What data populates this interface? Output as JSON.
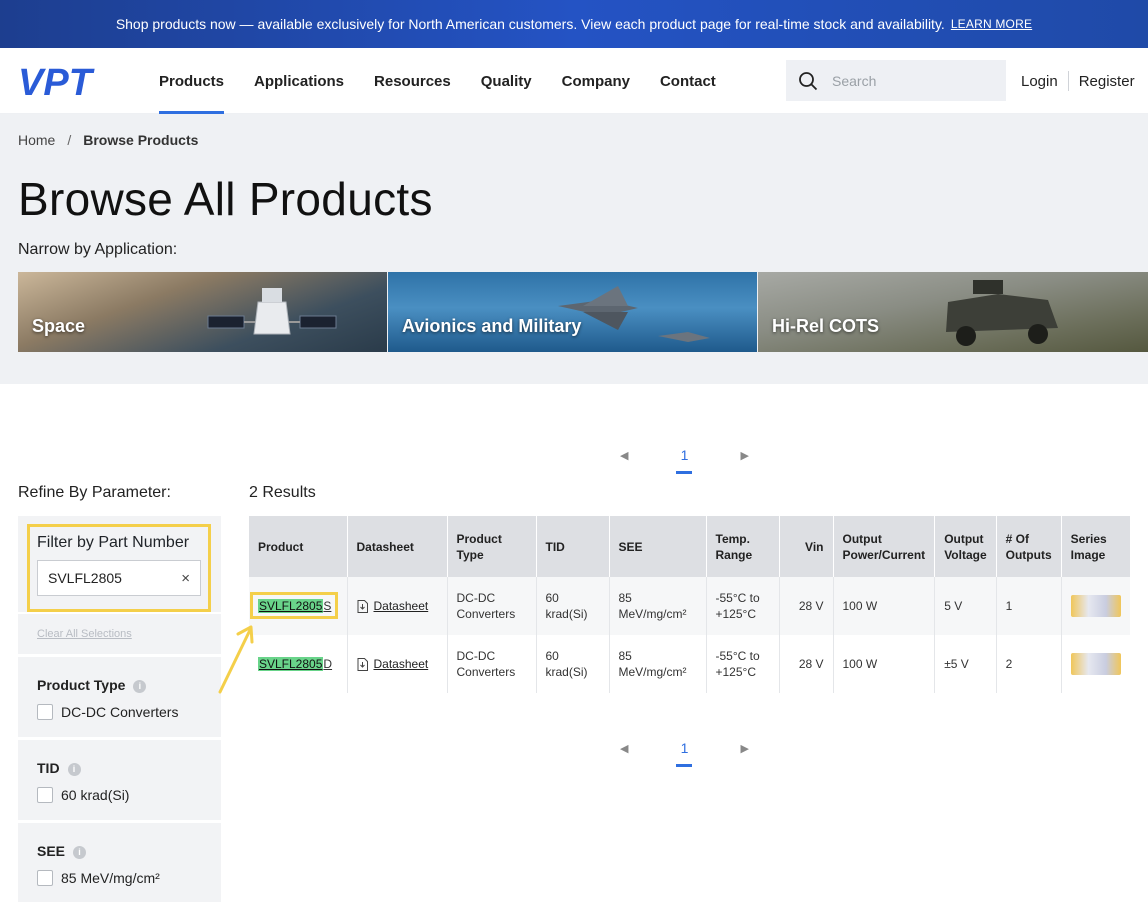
{
  "banner": {
    "text": "Shop products now — available exclusively for North American customers. View each product page for real-time stock and availability.",
    "link": "LEARN MORE"
  },
  "header": {
    "logo_text": "VPT",
    "nav": [
      "Products",
      "Applications",
      "Resources",
      "Quality",
      "Company",
      "Contact"
    ],
    "active_nav": "Products",
    "search_placeholder": "Search",
    "login": "Login",
    "register": "Register"
  },
  "breadcrumb": {
    "home": "Home",
    "separator": "/",
    "current": "Browse Products"
  },
  "page_title": "Browse All Products",
  "narrow_label": "Narrow by Application:",
  "applications": [
    "Space",
    "Avionics and Military",
    "Hi-Rel COTS"
  ],
  "pagination": {
    "current": "1"
  },
  "refine_label": "Refine By Parameter:",
  "results_label": "2 Results",
  "filters": {
    "part_number": {
      "title": "Filter by Part Number",
      "value": "SVLFL2805",
      "clear_glyph": "×"
    },
    "clear_all": "Clear All Selections",
    "product_type": {
      "title": "Product Type",
      "option": "DC-DC Converters"
    },
    "tid": {
      "title": "TID",
      "option": "60 krad(Si)"
    },
    "see": {
      "title": "SEE",
      "option": "85 MeV/mg/cm²"
    }
  },
  "table": {
    "headers": [
      "Product",
      "Datasheet",
      "Product Type",
      "TID",
      "SEE",
      "Temp. Range",
      "Vin",
      "Output Power/Current",
      "Output Voltage",
      "# Of Outputs",
      "Series Image"
    ],
    "rows": [
      {
        "highlight": "SVLFL2805",
        "suffix": "S",
        "datasheet": "Datasheet",
        "type": "DC-DC Converters",
        "tid": "60 krad(Si)",
        "see": "85 MeV/mg/cm²",
        "temp": "-55°C to +125°C",
        "vin": "28 V",
        "power": "100 W",
        "vout": "5 V",
        "outputs": "1"
      },
      {
        "highlight": "SVLFL2805",
        "suffix": "D",
        "datasheet": "Datasheet",
        "type": "DC-DC Converters",
        "tid": "60 krad(Si)",
        "see": "85 MeV/mg/cm²",
        "temp": "-55°C to +125°C",
        "vin": "28 V",
        "power": "100 W",
        "vout": "±5 V",
        "outputs": "2"
      }
    ]
  },
  "colors": {
    "accent": "#2f6fe0",
    "highlight_green": "#69d48a",
    "annotation_yellow": "#f4cf4a"
  }
}
